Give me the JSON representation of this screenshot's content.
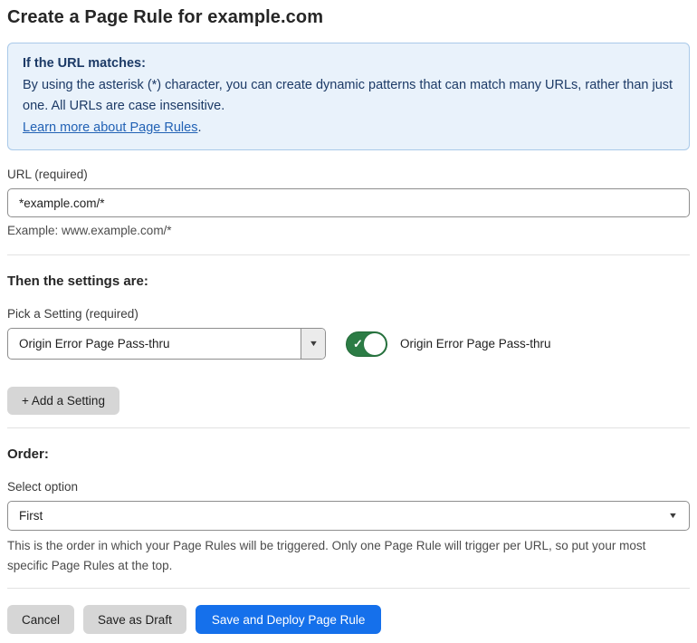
{
  "page": {
    "title": "Create a Page Rule for example.com"
  },
  "info_box": {
    "heading": "If the URL matches:",
    "body": "By using the asterisk (*) character, you can create dynamic patterns that can match many URLs, rather than just one. All URLs are case insensitive.",
    "link_label": "Learn more about Page Rules",
    "link_suffix": "."
  },
  "url_field": {
    "label": "URL (required)",
    "value": "*example.com/*",
    "helper": "Example: www.example.com/*"
  },
  "settings_section": {
    "heading": "Then the settings are:",
    "picker_label": "Pick a Setting (required)",
    "picker_value": "Origin Error Page Pass-thru",
    "toggle_state": "on",
    "toggle_label": "Origin Error Page Pass-thru",
    "add_setting_label": "+ Add a Setting"
  },
  "order_section": {
    "heading": "Order:",
    "select_label": "Select option",
    "select_value": "First",
    "helper": "This is the order in which your Page Rules will be triggered. Only one Page Rule will trigger per URL, so put your most specific Page Rules at the top."
  },
  "footer": {
    "cancel_label": "Cancel",
    "save_draft_label": "Save as Draft",
    "save_deploy_label": "Save and Deploy Page Rule"
  },
  "icons": {
    "picker_caret": "▼",
    "select_caret": "▼",
    "toggle_check": "✓"
  },
  "colors": {
    "info_bg": "#e9f2fb",
    "info_border": "#a9c9e9",
    "info_text": "#1c3a66",
    "link_blue": "#2262b5",
    "toggle_green": "#2c7c45",
    "primary_blue": "#1570eb",
    "button_gray": "#d6d6d6",
    "input_border": "#8e8e8e",
    "divider": "#e2e2e2"
  }
}
